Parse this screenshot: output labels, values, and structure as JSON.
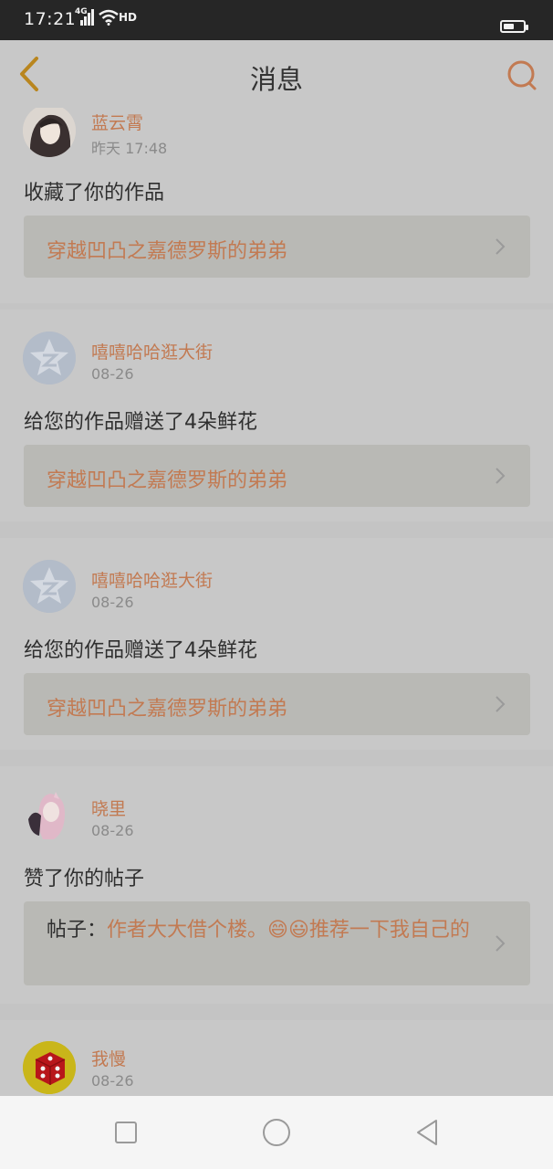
{
  "status_bar": {
    "time": "17:21",
    "network": "4G",
    "signal_icon": "signal-bars-icon",
    "wifi_icon": "wifi-icon",
    "hd_label": "HD",
    "battery_level": 0.55
  },
  "header": {
    "title": "消息",
    "back_icon": "back-chevron-icon",
    "search_icon": "search-icon",
    "accent_color": "#c27a52"
  },
  "messages": [
    {
      "user": "蓝云霄",
      "time": "昨天 17:48",
      "action": "收藏了你的作品",
      "work": "穿越凹凸之嘉德罗斯的弟弟",
      "avatar": "portrait-avatar"
    },
    {
      "user": "嘻嘻哈哈逛大街",
      "time": "08-26",
      "action": "给您的作品赠送了4朵鲜花",
      "work": "穿越凹凸之嘉德罗斯的弟弟",
      "avatar": "default-star-avatar"
    },
    {
      "user": "嘻嘻哈哈逛大街",
      "time": "08-26",
      "action": "给您的作品赠送了4朵鲜花",
      "work": "穿越凹凸之嘉德罗斯的弟弟",
      "avatar": "default-star-avatar"
    },
    {
      "user": "晓里",
      "time": "08-26",
      "action": "赞了你的帖子",
      "post_prefix": "帖子：",
      "post_text": "作者大大借个楼。😄😃推荐一下我自己的",
      "avatar": "anime-girl-avatar"
    },
    {
      "user": "我慢",
      "time": "08-26",
      "avatar": "red-dice-avatar"
    }
  ],
  "nav_bar": {
    "recents_icon": "square-recents-icon",
    "home_icon": "circle-home-icon",
    "back_icon": "triangle-back-icon"
  }
}
